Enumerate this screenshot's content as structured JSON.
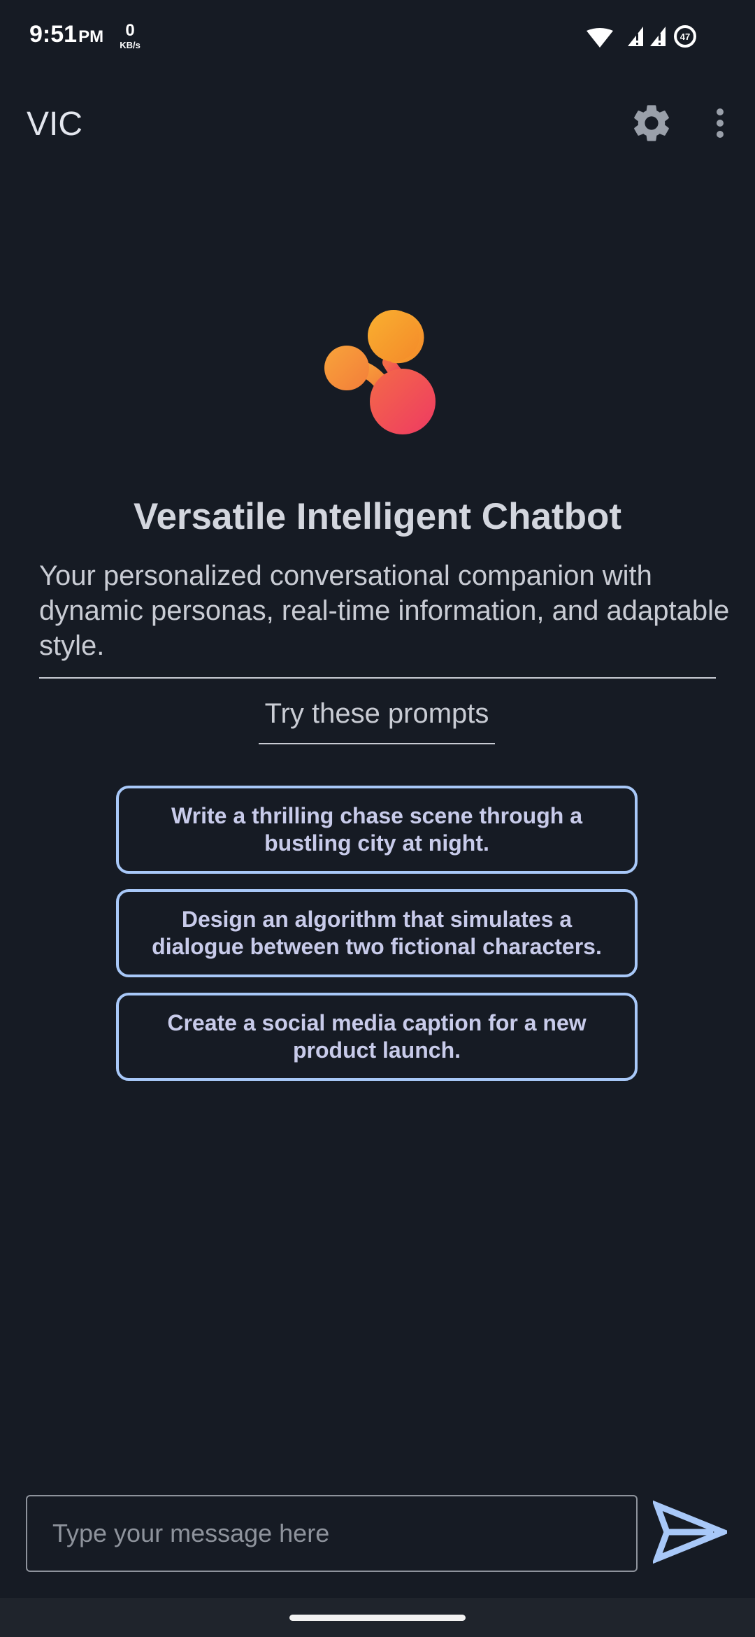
{
  "status_bar": {
    "time": "9:51",
    "ampm": "PM",
    "speed_value": "0",
    "speed_unit": "KB/s",
    "battery": "47"
  },
  "app_bar": {
    "title": "VIC",
    "icons": [
      "gear-icon",
      "more-vert-icon"
    ]
  },
  "hero": {
    "title": "Versatile Intelligent Chatbot",
    "description": "Your personalized conversational companion with dynamic personas, real-time information, and adaptable style."
  },
  "prompts": {
    "heading": "Try these prompts",
    "items": [
      "Write a thrilling chase scene through a bustling city at night.",
      "Design an algorithm that simulates a dialogue between two fictional characters.",
      "Create a social media caption for a new product launch."
    ]
  },
  "composer": {
    "placeholder": "Type your message here",
    "value": "",
    "send_icon": "send-icon"
  },
  "colors": {
    "background": "#161b24",
    "accent": "#a8c8f8",
    "logo_orange": "#f7a02c",
    "logo_pink": "#f0405a"
  }
}
